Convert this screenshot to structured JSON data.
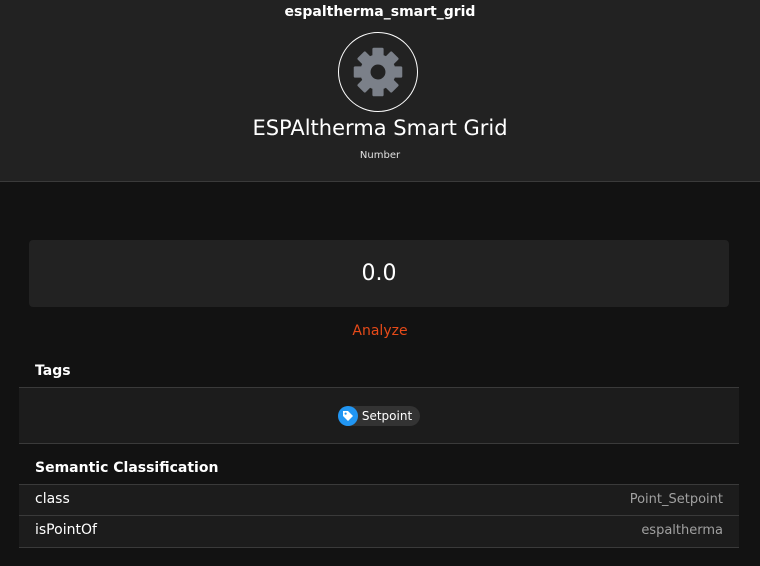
{
  "item": {
    "name": "espaltherma_smart_grid",
    "label": "ESPAltherma Smart Grid",
    "type": "Number",
    "icon": "gear-icon",
    "state": "0.0"
  },
  "actions": {
    "analyze_label": "Analyze"
  },
  "tags": {
    "title": "Tags",
    "items": [
      {
        "label": "Setpoint",
        "icon": "tag-icon"
      }
    ]
  },
  "semantic": {
    "title": "Semantic Classification",
    "rows": [
      {
        "key": "class",
        "value": "Point_Setpoint"
      },
      {
        "key": "isPointOf",
        "value": "espaltherma"
      }
    ]
  },
  "colors": {
    "accent": "#e64a19",
    "tag_icon_bg": "#2196f3",
    "background": "#121212",
    "header_bg": "#222222"
  }
}
